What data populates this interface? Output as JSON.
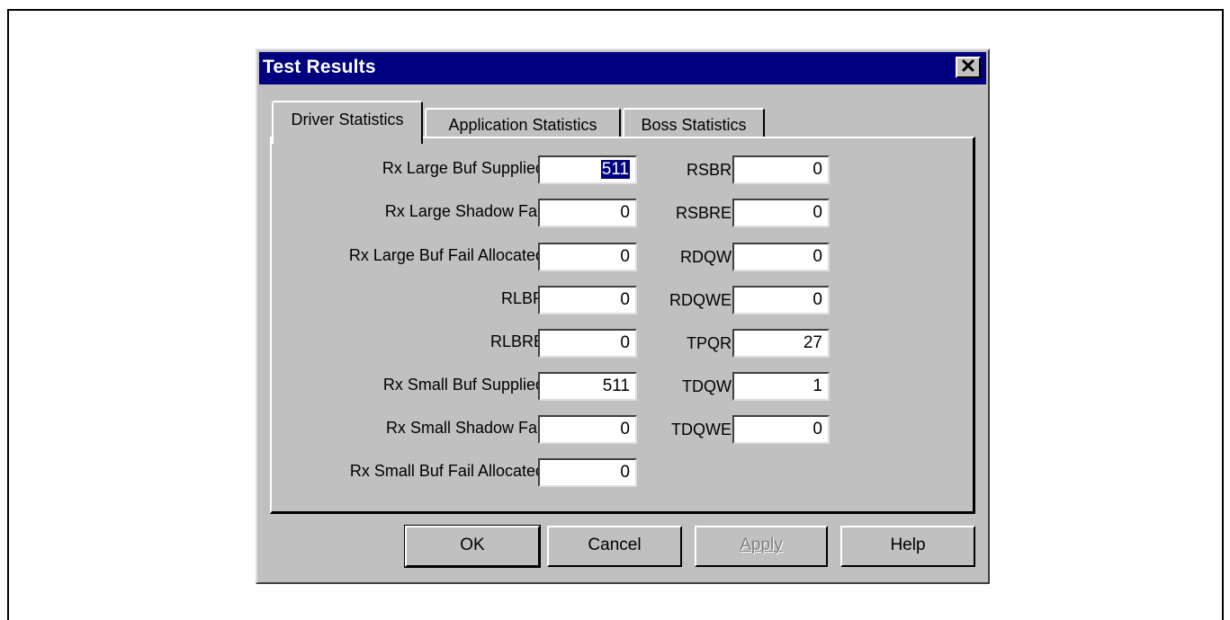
{
  "dialog": {
    "title": "Test Results",
    "close_glyph": "✕"
  },
  "tabs": [
    {
      "label": "Driver Statistics",
      "active": true
    },
    {
      "label": "Application Statistics",
      "active": false
    },
    {
      "label": "Boss Statistics",
      "active": false
    }
  ],
  "left_fields": [
    {
      "label": "Rx Large Buf Supplied",
      "value": "511",
      "selected": true
    },
    {
      "label": "Rx Large Shadow Fail",
      "value": "0"
    },
    {
      "label": "Rx Large Buf Fail Allocated",
      "value": "0"
    },
    {
      "label": "RLBR",
      "value": "0"
    },
    {
      "label": "RLBRE",
      "value": "0"
    },
    {
      "label": "Rx Small Buf Supplied",
      "value": "511"
    },
    {
      "label": "Rx Small Shadow Fail",
      "value": "0"
    },
    {
      "label": "Rx Small Buf Fail Allocated",
      "value": "0"
    }
  ],
  "right_fields": [
    {
      "label": "RSBR",
      "value": "0"
    },
    {
      "label": "RSBRE",
      "value": "0"
    },
    {
      "label": "RDQW",
      "value": "0"
    },
    {
      "label": "RDQWE",
      "value": "0"
    },
    {
      "label": "TPQR",
      "value": "27"
    },
    {
      "label": "TDQW",
      "value": "1"
    },
    {
      "label": "TDQWE",
      "value": "0"
    }
  ],
  "buttons": {
    "ok": "OK",
    "cancel": "Cancel",
    "apply": "Apply",
    "help": "Help"
  },
  "colors": {
    "titlebar": "#000080",
    "face": "#c0c0c0",
    "selection": "#000080"
  }
}
